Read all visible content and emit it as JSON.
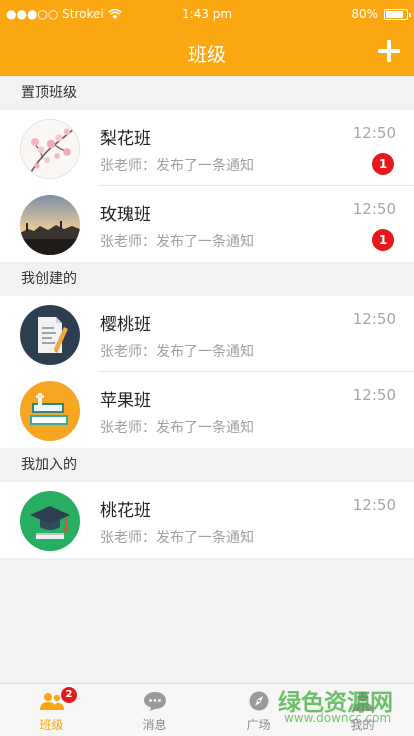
{
  "status_bar": {
    "carrier": "●●●○○ Strokei",
    "time": "1:43 pm",
    "battery": "80%"
  },
  "nav": {
    "title": "班级",
    "add_icon": "plus-icon"
  },
  "sections": {
    "pinned": "置顶班级",
    "created": "我创建的",
    "joined": "我加入的"
  },
  "classes": [
    {
      "name": "梨花班",
      "message": "张老师：发布了一条通知",
      "time": "12:50",
      "unread": "1",
      "avatar": "pear-blossom-avatar"
    },
    {
      "name": "玫瑰班",
      "message": "张老师：发布了一条通知",
      "time": "12:50",
      "unread": "1",
      "avatar": "landscape-avatar"
    },
    {
      "name": "樱桃班",
      "message": "张老师：发布了一条通知",
      "time": "12:50",
      "avatar": "notebook-avatar"
    },
    {
      "name": "苹果班",
      "message": "张老师：发布了一条通知",
      "time": "12:50",
      "avatar": "books-avatar"
    },
    {
      "name": "桃花班",
      "message": "张老师：发布了一条通知",
      "time": "12:50",
      "avatar": "graduation-cap-avatar"
    }
  ],
  "tabs": [
    {
      "label": "班级",
      "icon": "class-people-icon",
      "badge": "2",
      "active": true
    },
    {
      "label": "消息",
      "icon": "chat-bubble-icon"
    },
    {
      "label": "广场",
      "icon": "compass-icon"
    },
    {
      "label": "我的",
      "icon": "person-icon"
    }
  ],
  "watermark": {
    "text": "绿色资源网",
    "url": "www.downcc.com"
  },
  "colors": {
    "accent": "#fba711",
    "badge": "#e5191c",
    "background": "#f1f2f4"
  }
}
